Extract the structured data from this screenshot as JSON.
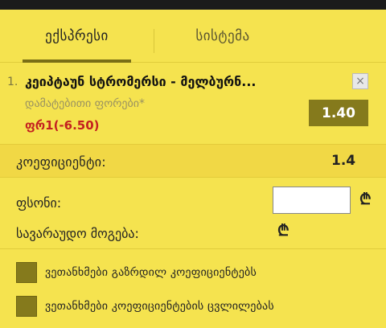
{
  "tabs": {
    "express_label": "ექსპრესი",
    "system_label": "სისტემა"
  },
  "bet": {
    "number": "1.",
    "title": "კეიპტაუნ სტრომერსი - მელბურნ...",
    "market": "დამატებითი ფორები*",
    "selection": "ფრ1(-6.50)",
    "odd": "1.40",
    "close_symbol": "×"
  },
  "coefficient": {
    "label": "კოეფიციენტი:",
    "value": "1.4"
  },
  "stake": {
    "label": "ფსონი:",
    "value": "",
    "currency_symbol": "₾"
  },
  "possible_win": {
    "label": "სავარაუდო მოგება:",
    "currency_symbol": "₾"
  },
  "checkboxes": [
    {
      "label": "ვეთანხმები გაზრდილ კოეფიციენტებს"
    },
    {
      "label": "ვეთანხმები კოეფიციენტების ცვლილებას"
    }
  ],
  "colors": {
    "background": "#f5e34f",
    "accent": "#857a1c",
    "selection_red": "#c42020"
  }
}
